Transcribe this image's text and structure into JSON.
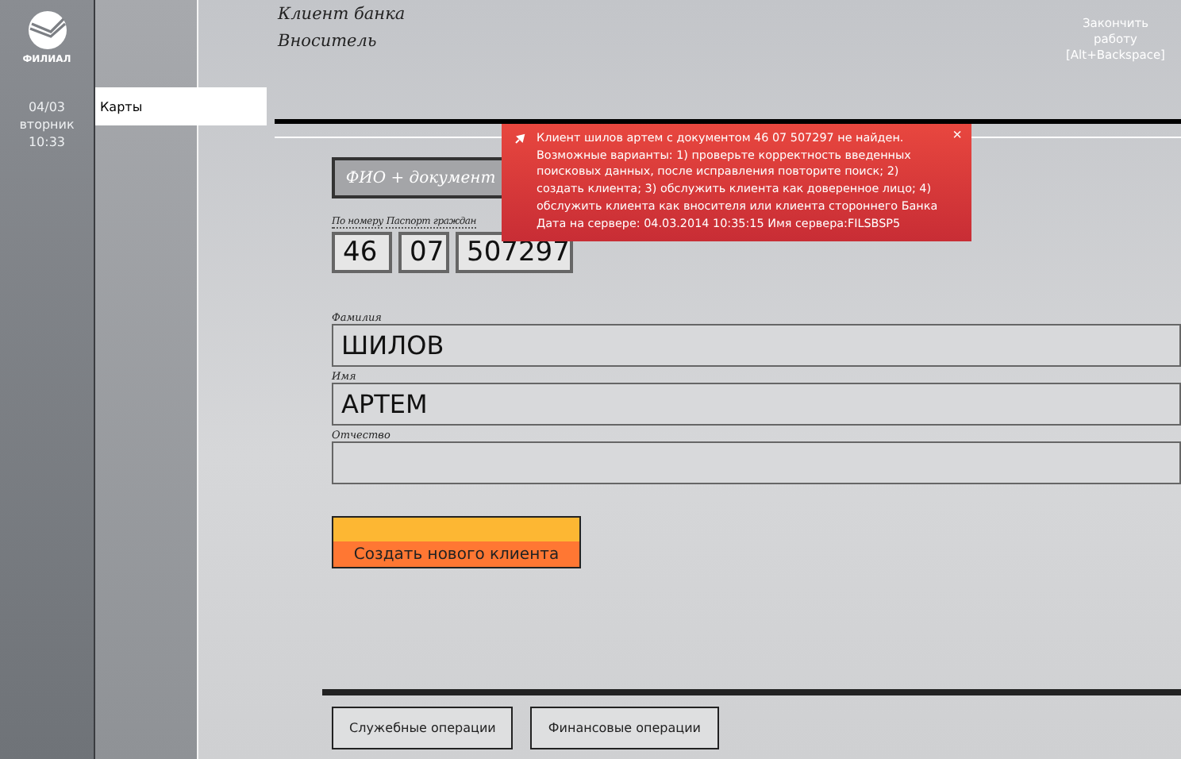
{
  "branch": {
    "logo_label": "ФИЛИАЛ",
    "date": "04/03",
    "weekday": "вторник",
    "time": "10:33"
  },
  "menu": [
    {
      "label": "Карты",
      "selected": true
    }
  ],
  "header": {
    "lines": [
      "Клиент банка",
      "Вноситель"
    ],
    "exit": [
      "Закончить",
      "работу",
      "[Alt+Backspace]"
    ]
  },
  "search_tab": {
    "label": "ФИО + документ"
  },
  "document": {
    "mode": "По номеру",
    "type": "Паспорт граждан",
    "fields": [
      "46",
      "07",
      "507297"
    ]
  },
  "person": [
    {
      "label": "Фамилия",
      "value": "ШИЛОВ"
    },
    {
      "label": "Имя",
      "value": "АРТЕМ"
    },
    {
      "label": "Отчество"
    }
  ],
  "create_button": "Создать нового клиента",
  "footer_buttons": [
    "Служебные операции",
    "Финансовые операции"
  ],
  "notification": {
    "lines": [
      "Клиент шилов артем с документом 46 07 507297 не найден.",
      "Возможные варианты: 1) проверьте корректность введенных поисковых данных, после исправления повторите поиск; 2) создать клиента; 3) обслужить клиента как доверенное лицо; 4) обслужить клиента как вносителя или клиента стороннего Банка",
      "Дата на сервере: 04.03.2014 10:35:15 Имя сервера:FILSBSP5"
    ],
    "close": "×"
  }
}
